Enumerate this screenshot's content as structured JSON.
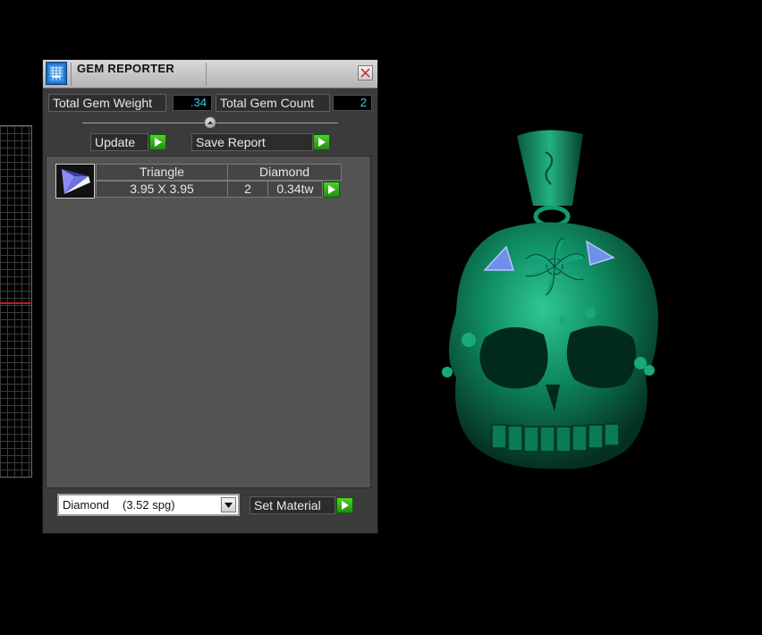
{
  "window": {
    "title": "GEM REPORTER",
    "close_icon": "close-icon"
  },
  "summary": {
    "weight_label": "Total Gem Weight",
    "weight_value": ".34",
    "count_label": "Total Gem Count",
    "count_value": "2"
  },
  "actions": {
    "update_label": "Update",
    "save_report_label": "Save Report"
  },
  "gem_list": [
    {
      "shape": "Triangle",
      "material": "Diamond",
      "size": "3.95 X 3.95",
      "count": "2",
      "weight": "0.34tw"
    }
  ],
  "material_selector": {
    "name": "Diamond",
    "spg": "(3.52 spg)",
    "set_label": "Set Material"
  },
  "colors": {
    "panel_bg": "#3b3b3b",
    "value_text": "#3fc8ea",
    "accent_green": "#2fb41a",
    "model_green": "#0f7a58",
    "gem_blue": "#6f8fe8",
    "axis_red": "#c81818"
  }
}
